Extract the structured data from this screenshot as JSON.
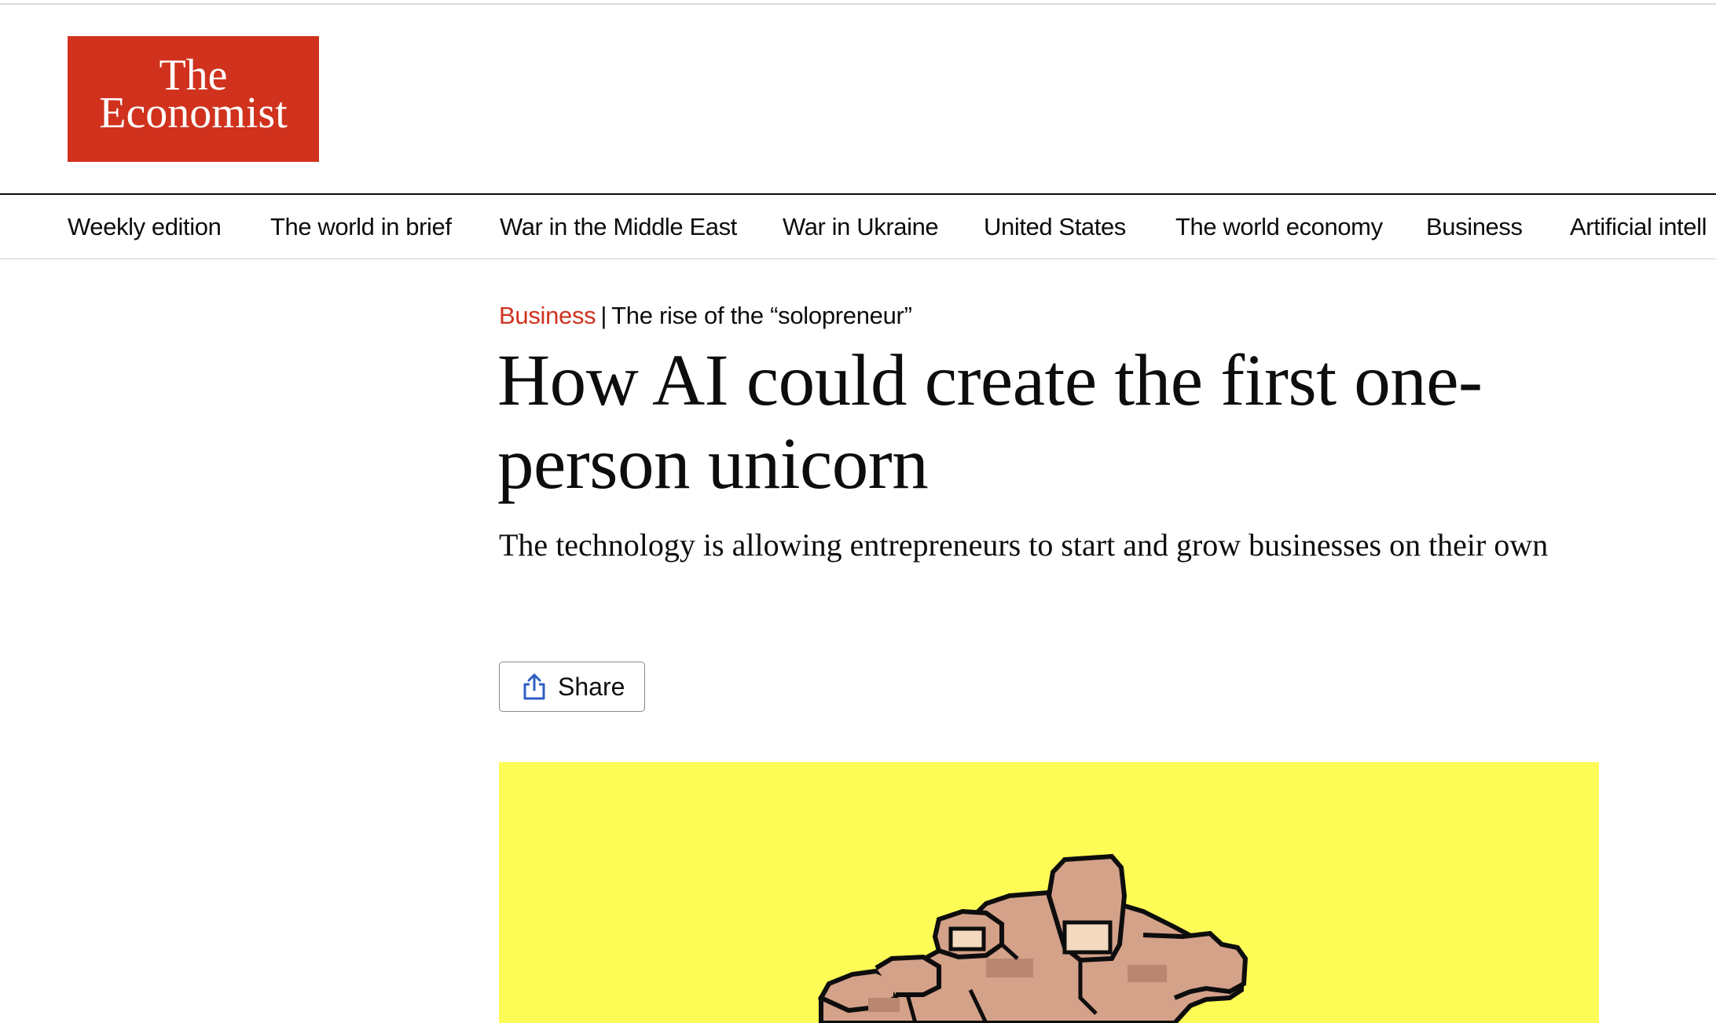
{
  "logo": {
    "line1": "The",
    "line2": "Economist"
  },
  "nav": {
    "items": [
      "Weekly edition",
      "The world in brief",
      "War in the Middle East",
      "War in Ukraine",
      "United States",
      "The world economy",
      "Business",
      "Artificial intell"
    ]
  },
  "article": {
    "section": "Business",
    "separator": "|",
    "flytitle": "The rise of the “solopreneur”",
    "headline": "How AI could create the first one-person unicorn",
    "standfirst": "The technology is allowing entrepreneurs to start and grow businesses on their own",
    "share_label": "Share"
  },
  "hero": {
    "background_color": "#fdfb56",
    "description_icon": "pixel-art-hand-icon"
  },
  "colors": {
    "brand_red": "#d0321e",
    "text": "#0d0d0d",
    "share_icon_blue": "#2f5fc4"
  }
}
